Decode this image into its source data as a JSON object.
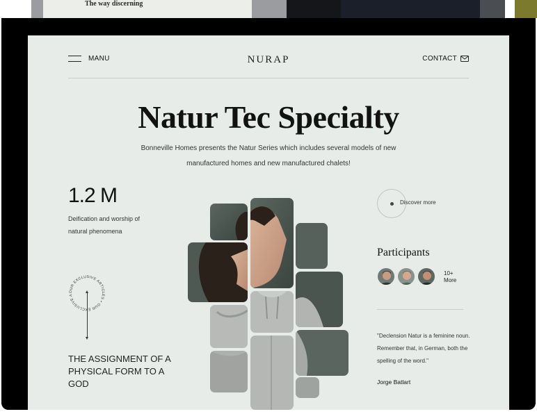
{
  "top_strip": {
    "snippet_text": "The way discerning"
  },
  "nav": {
    "menu_label": "MANU",
    "logo": "NURAP",
    "contact_label": "CONTACT"
  },
  "hero": {
    "title": "Natur Tec Specialty",
    "subtitle": "Bonneville Homes presents the Natur Series which includes several models of new manufactured homes and new manufactured chalets!"
  },
  "stat": {
    "value": "1.2 M",
    "description": "Deification and worship of natural phenomena"
  },
  "badge": {
    "circular_text": "OUR EXCLUSIVE ARTICLES • OUR EXCLUSIVE ARTICLES •"
  },
  "assignment": {
    "text": "THE ASSIGNMENT OF A PHYSICAL FORM TO A GOD"
  },
  "discover": {
    "label": "Discover more"
  },
  "participants": {
    "title": "Participants",
    "more_count": "10+",
    "more_label": "More"
  },
  "quote": {
    "text": "\"Declension Natur is a feminine noun. Remember that, in German, both the spelling of the word.\"",
    "author": "Jorge Batlart"
  },
  "colors": {
    "page_bg": "#e7ece8",
    "frame": "#000000",
    "text": "#111111"
  },
  "icons": {
    "menu": "hamburger-icon",
    "contact": "mail-icon",
    "discover": "dot-icon",
    "scroll": "double-arrow-icon"
  }
}
